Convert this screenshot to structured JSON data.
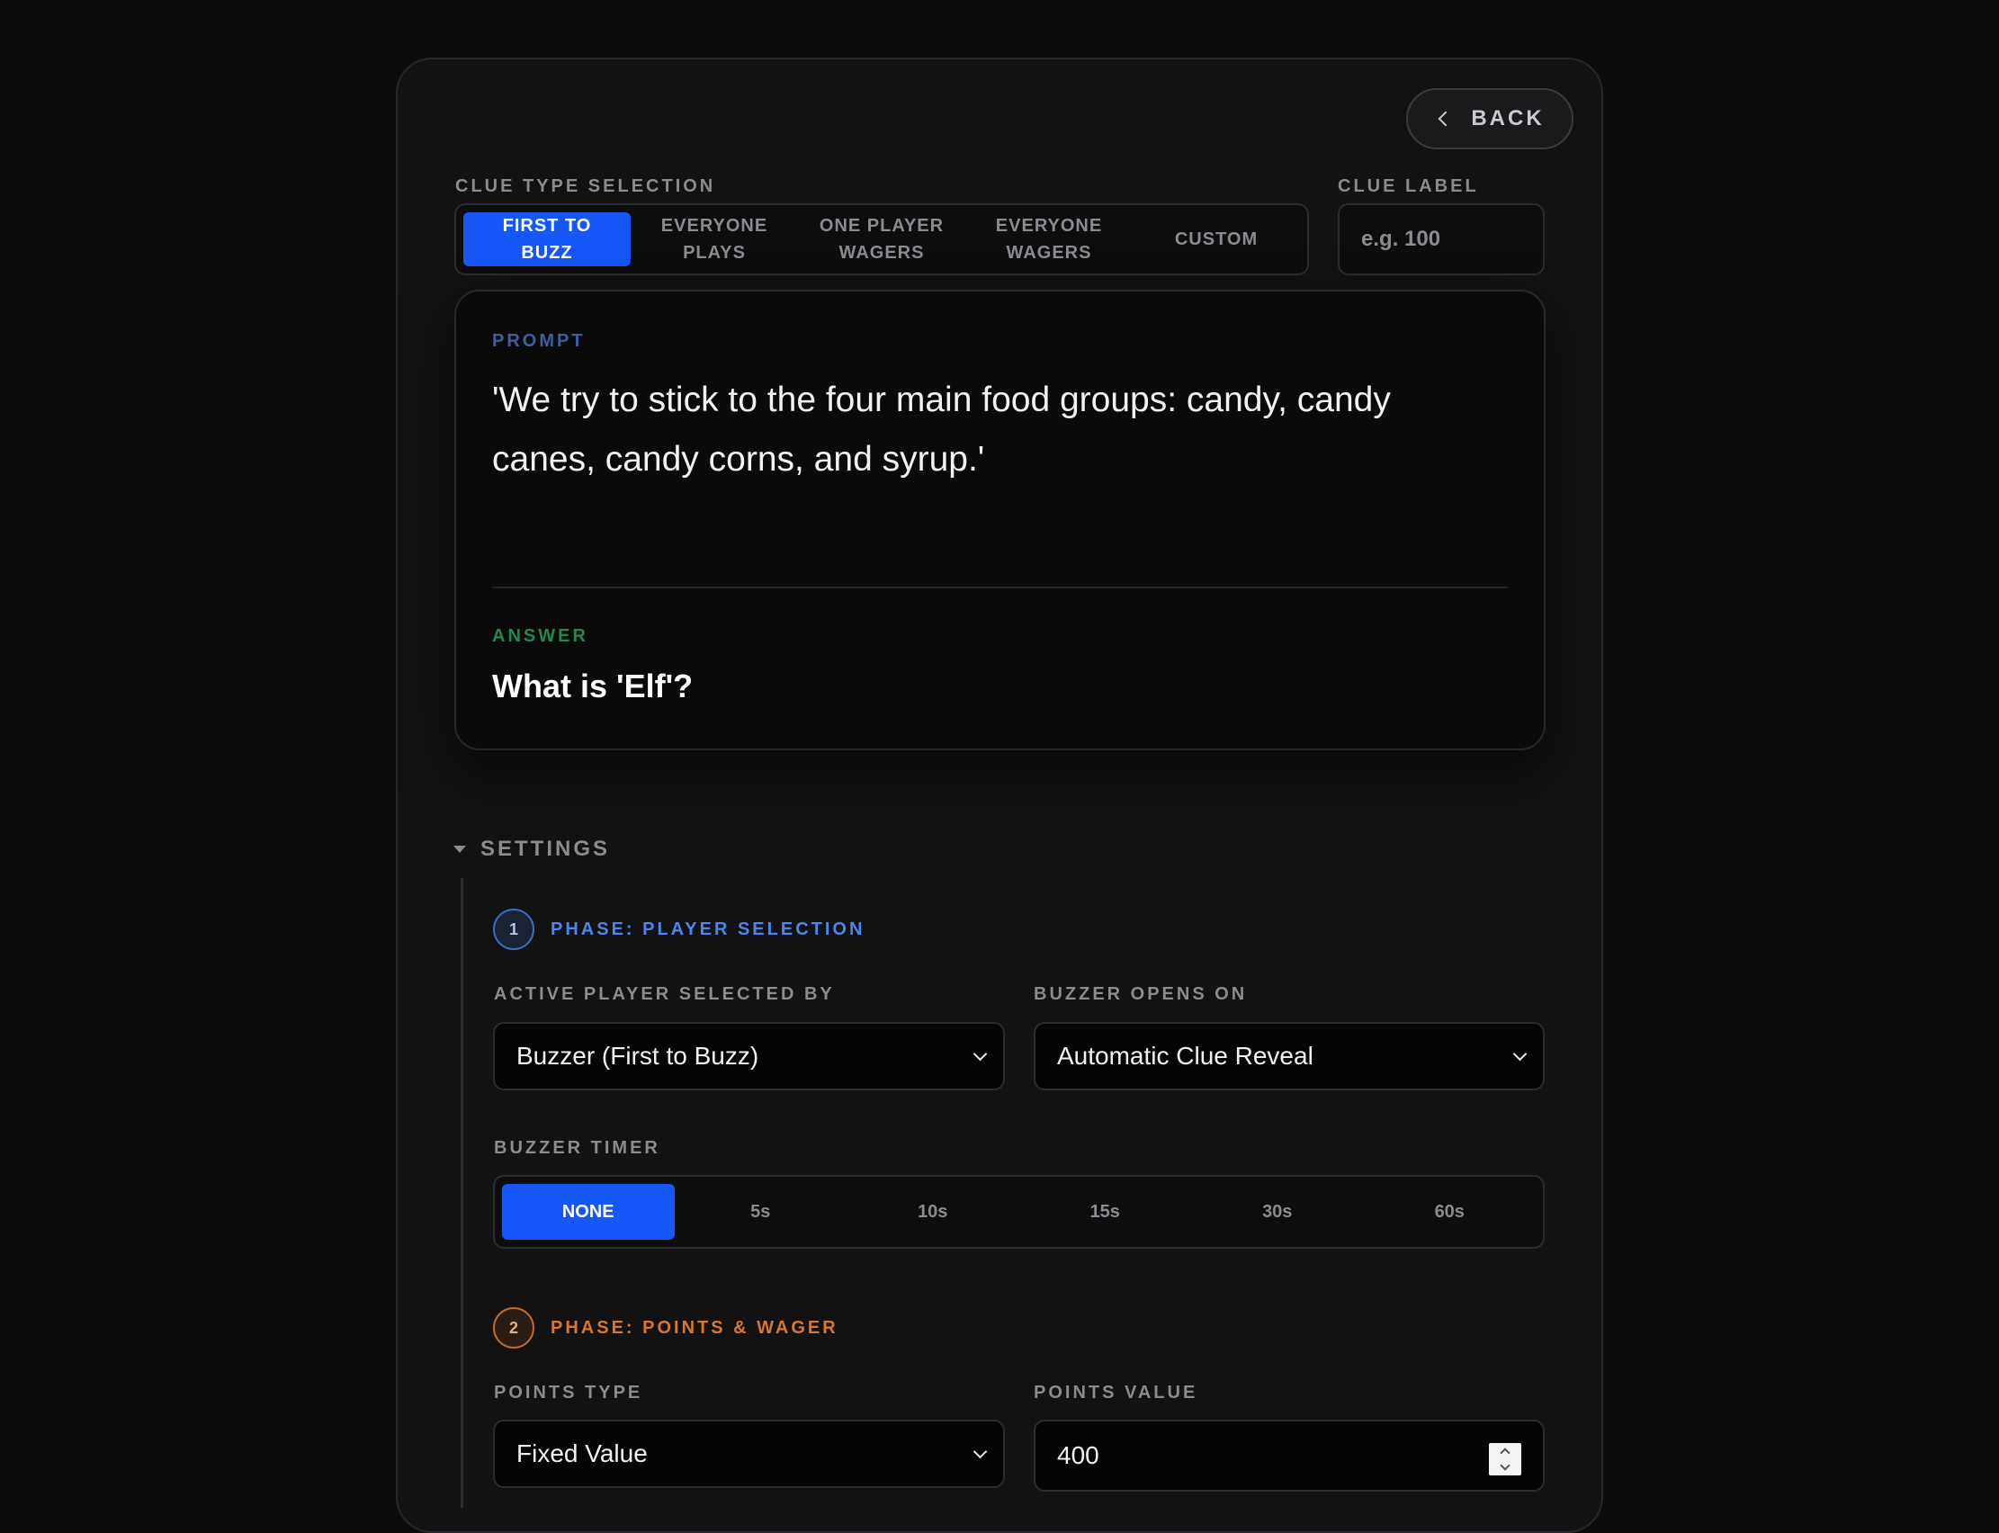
{
  "header": {
    "back_label": "BACK"
  },
  "clue_type": {
    "label": "CLUE TYPE SELECTION",
    "options": [
      {
        "line1": "FIRST TO",
        "line2": "BUZZ"
      },
      {
        "line1": "EVERYONE",
        "line2": "PLAYS"
      },
      {
        "line1": "ONE PLAYER",
        "line2": "WAGERS"
      },
      {
        "line1": "EVERYONE",
        "line2": "WAGERS"
      },
      {
        "line1": "CUSTOM",
        "line2": ""
      }
    ],
    "selected_index": 0
  },
  "clue_label": {
    "label": "CLUE LABEL",
    "placeholder": "e.g. 100"
  },
  "clue": {
    "prompt_label": "PROMPT",
    "prompt_text": "'We try to stick to the four main food groups: candy, candy canes, candy corns, and syrup.'",
    "answer_label": "ANSWER",
    "answer_text": "What is 'Elf'?"
  },
  "settings": {
    "toggle_label": "SETTINGS",
    "phase1": {
      "number": "1",
      "title": "PHASE: PLAYER SELECTION",
      "active_player_label": "ACTIVE PLAYER SELECTED BY",
      "active_player_value": "Buzzer (First to Buzz)",
      "buzzer_opens_label": "BUZZER OPENS ON",
      "buzzer_opens_value": "Automatic Clue Reveal",
      "buzzer_timer_label": "BUZZER TIMER",
      "timer_options": [
        "NONE",
        "5s",
        "10s",
        "15s",
        "30s",
        "60s"
      ],
      "timer_selected_index": 0
    },
    "phase2": {
      "number": "2",
      "title": "PHASE: POINTS & WAGER",
      "points_type_label": "POINTS TYPE",
      "points_type_value": "Fixed Value",
      "points_value_label": "POINTS VALUE",
      "points_value": "400"
    }
  },
  "colors": {
    "accent": "#1657f8",
    "phase1": "#4a86f0",
    "phase2": "#d9782a",
    "answer": "#1f8a4c"
  }
}
